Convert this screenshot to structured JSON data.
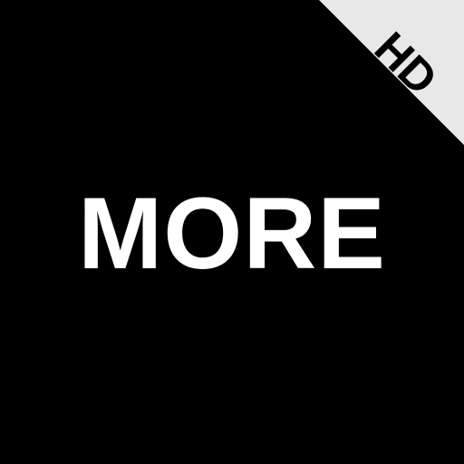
{
  "tile": {
    "label": "MORE",
    "badge": "HD"
  },
  "colors": {
    "background": "#000000",
    "label_text": "#ffffff",
    "corner_band": "#e8e8e8",
    "badge_text": "#000000"
  }
}
